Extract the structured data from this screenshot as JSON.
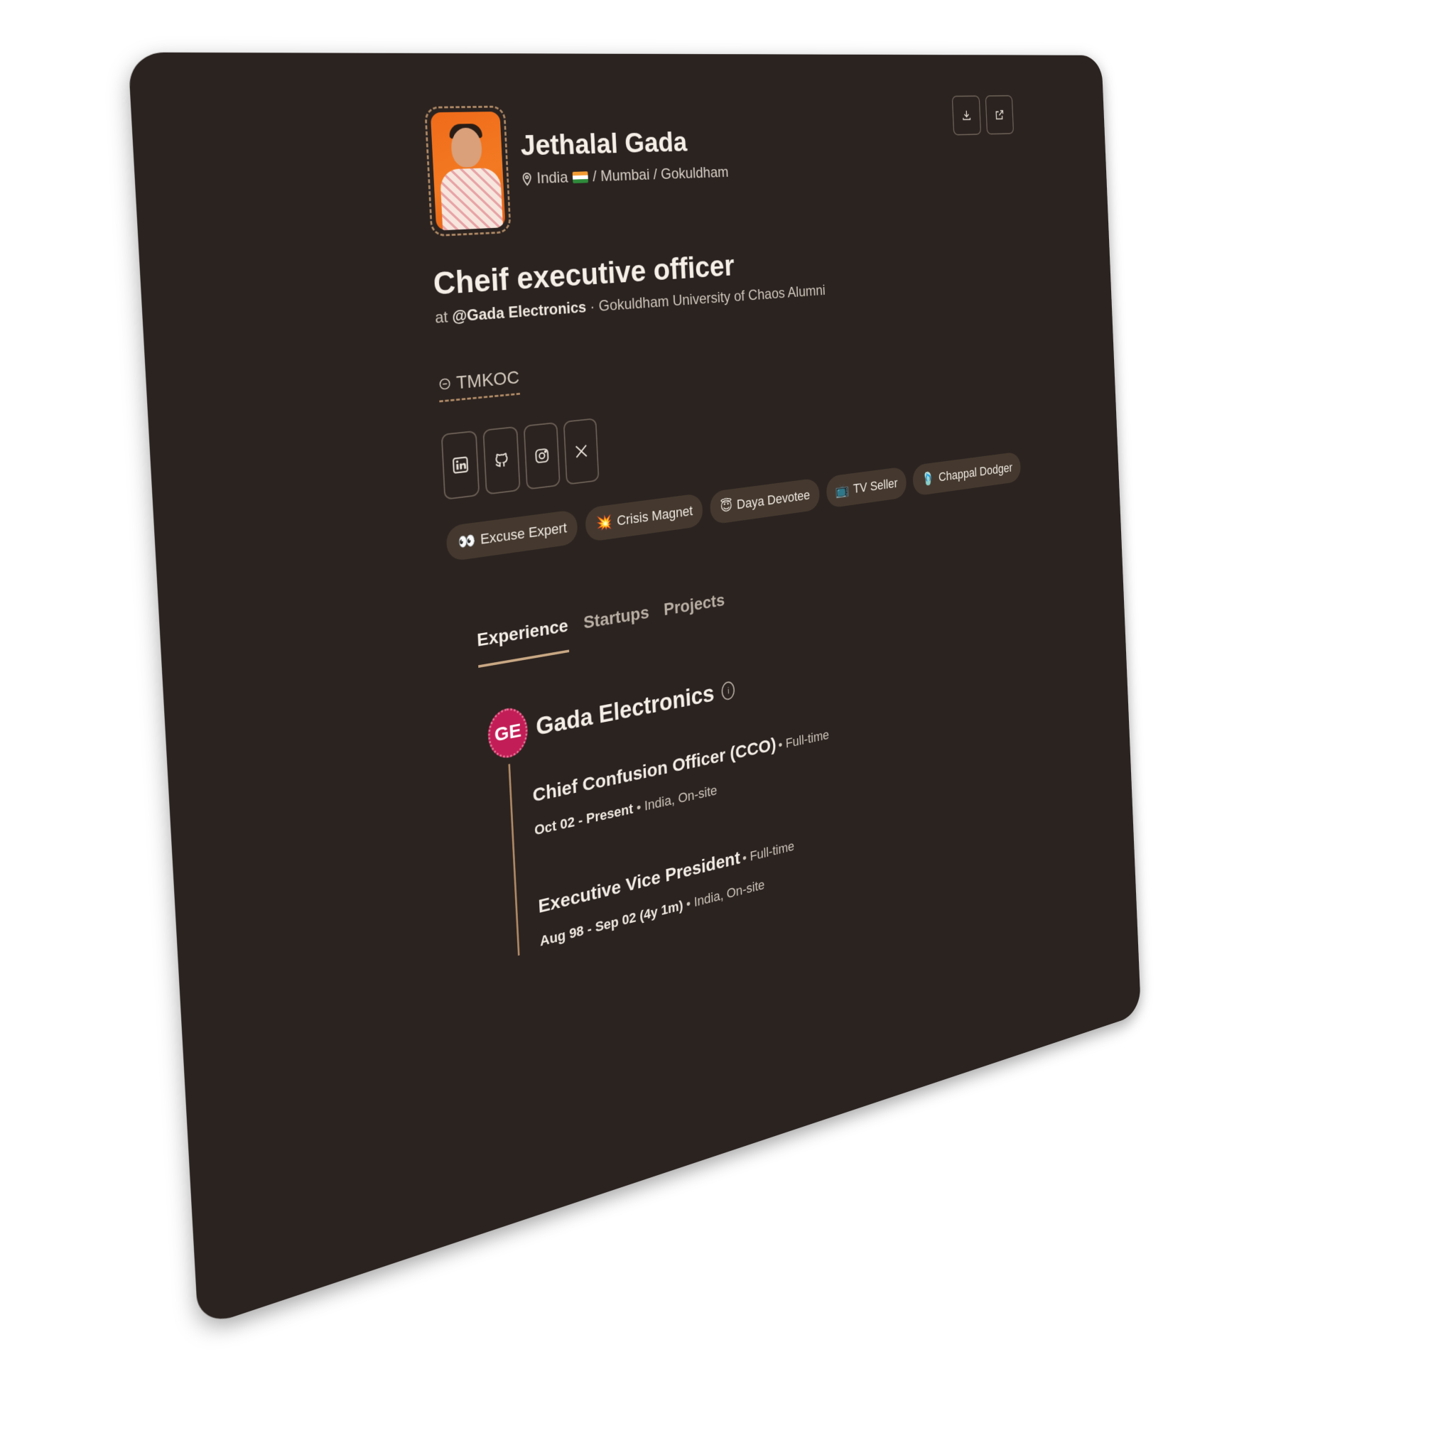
{
  "profile": {
    "name": "Jethalal Gada",
    "location": [
      "India",
      "/ Mumbai / Gokuldham"
    ],
    "role": "Cheif executive officer",
    "sub": {
      "at": "at",
      "company": "@Gada Electronics",
      "rest": "· Gokuldham University of Chaos Alumni"
    },
    "link": "TMKOC"
  },
  "socials": [
    "linkedin-icon",
    "github-icon",
    "instagram-icon",
    "x-icon"
  ],
  "badges": [
    {
      "emoji": "👀",
      "label": "Excuse Expert"
    },
    {
      "emoji": "💥",
      "label": "Crisis Magnet"
    },
    {
      "emoji": "😇",
      "label": "Daya Devotee"
    },
    {
      "emoji": "📺",
      "label": "TV Seller"
    },
    {
      "emoji": "🩴",
      "label": "Chappal Dodger"
    }
  ],
  "tabs": [
    "Experience",
    "Startups",
    "Projects"
  ],
  "experience": {
    "company": "Gada Electronics",
    "logo": "GE",
    "jobs": [
      {
        "title": "Chief Confusion Officer (CCO)",
        "type": "• Full-time",
        "dates": "Oct 02 - Present",
        "location": "• India, On-site"
      },
      {
        "title": "Executive Vice President",
        "type": "• Full-time",
        "dates": "Aug 98 - Sep 02 (4y 1m)",
        "location": "• India, On-site"
      }
    ]
  },
  "colors": {
    "card": "#2b2320",
    "accent": "#b08a66",
    "badge": "#45392f",
    "logo": "#c21d56"
  }
}
